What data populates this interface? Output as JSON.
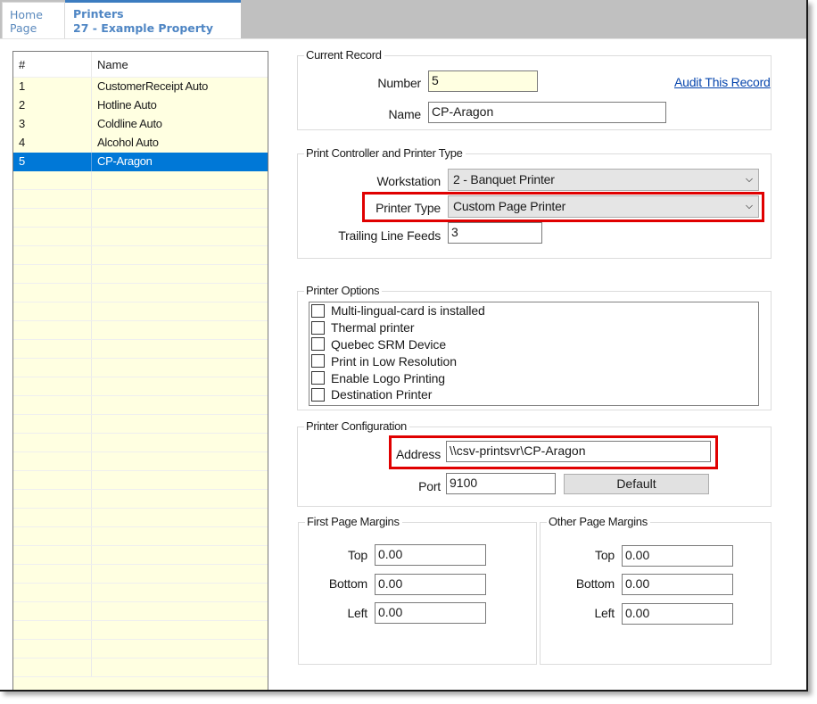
{
  "tabs": {
    "home": {
      "line1": "Home",
      "line2": "Page"
    },
    "active": {
      "line1": "Printers",
      "line2": "27 - Example Property"
    }
  },
  "list": {
    "columns": [
      "#",
      "Name"
    ],
    "rows": [
      {
        "num": "1",
        "name": "CustomerReceipt Auto"
      },
      {
        "num": "2",
        "name": "Hotline Auto"
      },
      {
        "num": "3",
        "name": "Coldline Auto"
      },
      {
        "num": "4",
        "name": "Alcohol Auto"
      },
      {
        "num": "5",
        "name": "CP-Aragon",
        "selected": true
      }
    ],
    "empty_rows": 27
  },
  "current_record": {
    "title": "Current Record",
    "number_label": "Number",
    "number_value": "5",
    "name_label": "Name",
    "name_value": "CP-Aragon",
    "audit_link": "Audit This Record"
  },
  "print_controller": {
    "title": "Print Controller and Printer Type",
    "workstation_label": "Workstation",
    "workstation_value": "2 - Banquet Printer",
    "printer_type_label": "Printer Type",
    "printer_type_value": "Custom Page Printer",
    "trailing_label": "Trailing Line Feeds",
    "trailing_value": "3"
  },
  "printer_options": {
    "title": "Printer Options",
    "options": [
      {
        "label": "Multi-lingual-card is installed",
        "checked": false
      },
      {
        "label": "Thermal printer",
        "checked": false
      },
      {
        "label": "Quebec SRM Device",
        "checked": false
      },
      {
        "label": "Print in Low Resolution",
        "checked": false
      },
      {
        "label": "Enable Logo Printing",
        "checked": false
      },
      {
        "label": "Destination Printer",
        "checked": false
      }
    ]
  },
  "printer_config": {
    "title": "Printer Configuration",
    "address_label": "Address",
    "address_value": "\\\\csv-printsvr\\CP-Aragon",
    "port_label": "Port",
    "port_value": "9100",
    "default_button": "Default"
  },
  "first_page_margins": {
    "title": "First Page Margins",
    "top_label": "Top",
    "top_value": "0.00",
    "bottom_label": "Bottom",
    "bottom_value": "0.00",
    "left_label": "Left",
    "left_value": "0.00"
  },
  "other_page_margins": {
    "title": "Other Page Margins",
    "top_label": "Top",
    "top_value": "0.00",
    "bottom_label": "Bottom",
    "bottom_value": "0.00",
    "left_label": "Left",
    "left_value": "0.00"
  },
  "colors": {
    "highlight_box": "#e00000",
    "selection": "#0078d7",
    "list_background": "#ffffe1",
    "tab_accent": "#3c7cc0"
  }
}
